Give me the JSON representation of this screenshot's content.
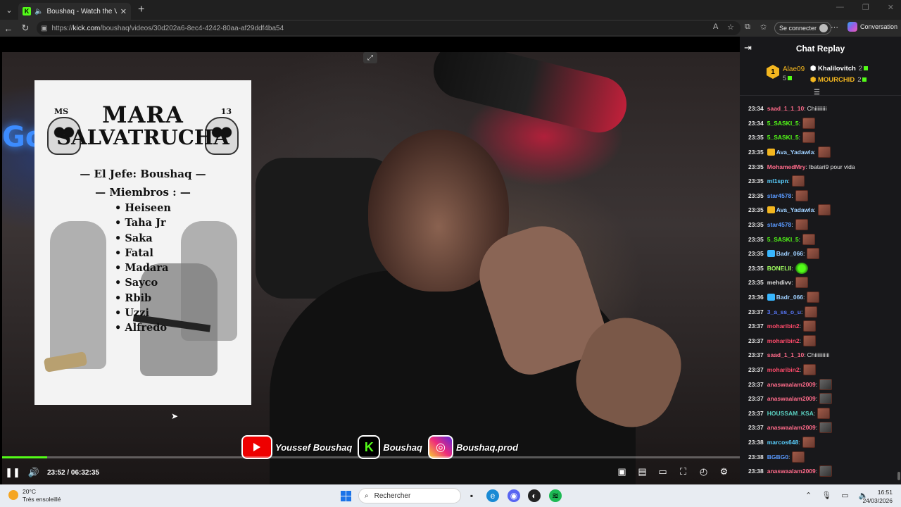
{
  "browser": {
    "tab_title": "Boushaq - Watch the VOD on",
    "url_prefix": "https://",
    "url_host": "kick.com",
    "url_path": "/boushaq/videos/30d202a6-8ec4-4242-80aa-af29ddf4ba54",
    "signin_label": "Se connecter",
    "copilot_label": "Conversation"
  },
  "poster": {
    "ms": "MS",
    "num": "13",
    "title_line1": "MARA",
    "title_line2": "SALVATRUCHA",
    "jefe": "— El Jefe: Boushaq —",
    "miembros": "— Miembros : —",
    "members": [
      "Heiseen",
      "Taha Jr",
      "Saka",
      "Fatal",
      "Madara",
      "Sayco",
      "Rbib",
      "Uzzi",
      "Alfredo"
    ]
  },
  "socials": {
    "youtube": "Youssef Boushaq",
    "kick": "Boushaq",
    "instagram": "Boushaq.prod"
  },
  "player": {
    "time": "23:52 / 06:32:35",
    "progress": 0.061
  },
  "chat": {
    "title": "Chat Replay",
    "leaderboard": {
      "first": {
        "rank": "1",
        "name": "Alae09",
        "count": "5"
      },
      "second": {
        "name": "Khalilovitch",
        "count": "2"
      },
      "third": {
        "name": "MOURCHID",
        "count": "2"
      }
    },
    "messages": [
      {
        "time": "23:34",
        "user": "saad_1_1_10",
        "color": "#ff6b8a",
        "text": "Chiiiiiiiii",
        "emote": ""
      },
      {
        "time": "23:34",
        "user": "5_SASKI_5",
        "color": "#53fc18",
        "text": "",
        "emote": "brown"
      },
      {
        "time": "23:35",
        "user": "5_SASKI_5",
        "color": "#53fc18",
        "text": "",
        "emote": "brown"
      },
      {
        "time": "23:35",
        "user": "Ava_Yadawla",
        "color": "#9fd0ff",
        "text": "",
        "emote": "brown",
        "badge": "crown"
      },
      {
        "time": "23:35",
        "user": "MohamedMry",
        "color": "#ff6b8a",
        "text": "Ibatari9 pour vida",
        "emote": ""
      },
      {
        "time": "23:35",
        "user": "ml1spn",
        "color": "#5ad0ff",
        "text": "",
        "emote": "brown"
      },
      {
        "time": "23:35",
        "user": "star4578",
        "color": "#5a9aff",
        "text": "",
        "emote": "brown"
      },
      {
        "time": "23:35",
        "user": "Ava_Yadawla",
        "color": "#9fd0ff",
        "text": "",
        "emote": "brown",
        "badge": "crown"
      },
      {
        "time": "23:35",
        "user": "star4578",
        "color": "#5a9aff",
        "text": "",
        "emote": "brown"
      },
      {
        "time": "23:35",
        "user": "5_SASKI_5",
        "color": "#53fc18",
        "text": "",
        "emote": "brown"
      },
      {
        "time": "23:35",
        "user": "Badr_066",
        "color": "#9fd0ff",
        "text": "",
        "emote": "brown",
        "badge": "gift"
      },
      {
        "time": "23:35",
        "user": "BONELII",
        "color": "#a0ff60",
        "text": "",
        "emote": "green"
      },
      {
        "time": "23:35",
        "user": "mehdivv",
        "color": "#e0e0e0",
        "text": "",
        "emote": "brown"
      },
      {
        "time": "23:36",
        "user": "Badr_066",
        "color": "#9fd0ff",
        "text": "",
        "emote": "brown",
        "badge": "gift"
      },
      {
        "time": "23:37",
        "user": "3_a_ss_o_u",
        "color": "#5a7aff",
        "text": "",
        "emote": "brown"
      },
      {
        "time": "23:37",
        "user": "moharibin2",
        "color": "#ff4a6a",
        "text": "",
        "emote": "brown"
      },
      {
        "time": "23:37",
        "user": "moharibin2",
        "color": "#ff4a6a",
        "text": "",
        "emote": "brown"
      },
      {
        "time": "23:37",
        "user": "saad_1_1_10",
        "color": "#ff6b8a",
        "text": "Chiiiiiiiiiii",
        "emote": ""
      },
      {
        "time": "23:37",
        "user": "moharibin2",
        "color": "#ff4a6a",
        "text": "",
        "emote": "brown"
      },
      {
        "time": "23:37",
        "user": "anaswaalam2009",
        "color": "#ff6b8a",
        "text": "",
        "emote": "gray"
      },
      {
        "time": "23:37",
        "user": "anaswaalam2009",
        "color": "#ff6b8a",
        "text": "",
        "emote": "gray"
      },
      {
        "time": "23:37",
        "user": "HOUSSAM_KSA",
        "color": "#5ad0c0",
        "text": "",
        "emote": "brown"
      },
      {
        "time": "23:37",
        "user": "anaswaalam2009",
        "color": "#ff6b8a",
        "text": "",
        "emote": "gray"
      },
      {
        "time": "23:38",
        "user": "marcos648",
        "color": "#5ad0ff",
        "text": "",
        "emote": "brown"
      },
      {
        "time": "23:38",
        "user": "BGBG0",
        "color": "#5a9aff",
        "text": "",
        "emote": "brown"
      },
      {
        "time": "23:38",
        "user": "anaswaalam2009",
        "color": "#ff6b8a",
        "text": "",
        "emote": "gray"
      }
    ]
  },
  "taskbar": {
    "temp": "20°C",
    "weather": "Très ensoleillé",
    "search_placeholder": "Rechercher",
    "time": "16:51",
    "date": "24/03/2026"
  },
  "colors": {
    "kick_green": "#53fc18",
    "gold": "#f3b61f"
  }
}
